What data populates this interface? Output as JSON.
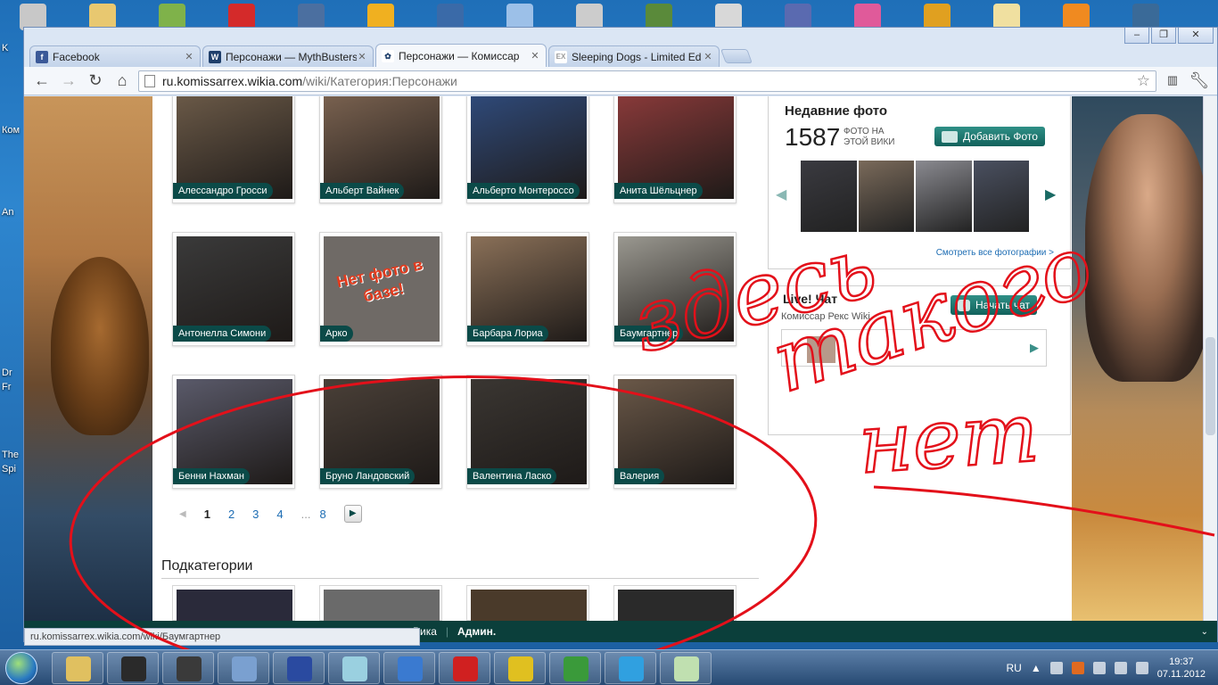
{
  "desktop": {
    "left_labels": [
      "K",
      "Ком",
      "An",
      "Dr",
      "Fr",
      "The",
      "Spi"
    ],
    "icon_colors": [
      "#c8c8c8",
      "#e8c870",
      "#7fb24a",
      "#d42a2a",
      "#4b6fa0",
      "#f0b020",
      "#3a6aa8",
      "#9cc0e8",
      "#cccccc",
      "#5a8a3a",
      "#d8d8d8",
      "#5a6ab0",
      "#e05a9a",
      "#e0a020",
      "#f0e0a0",
      "#f08a20",
      "#3a6a98"
    ]
  },
  "browser": {
    "tabs": [
      {
        "label": "Facebook",
        "icon": "facebook-icon",
        "icon_glyph": "f",
        "color": "#3b5998"
      },
      {
        "label": "Персонажи — MythBusters",
        "icon": "wikia-icon",
        "icon_glyph": "W",
        "color": "#1f3f6b"
      },
      {
        "label": "Персонажи — Комиссар",
        "icon": "wikia-icon",
        "icon_glyph": "✿",
        "color": "#1f3f6b",
        "active": true
      },
      {
        "label": "Sleeping Dogs - Limited Ed",
        "icon": "ex-icon",
        "icon_glyph": "EX",
        "color": "#9a9a9a"
      }
    ],
    "close_glyph": "✕",
    "url_host": "ru.komissarrex.wikia.com",
    "url_path": "/wiki/Категория:Персонажи"
  },
  "characters": [
    {
      "name": "Алессандро Гросси",
      "color": "#6b5a48"
    },
    {
      "name": "Альберт Вайнек",
      "color": "#7a6250"
    },
    {
      "name": "Альберто Монтероссо",
      "color": "#2f4a7a"
    },
    {
      "name": "Анита Шёльцнер",
      "color": "#8a3a3a"
    },
    {
      "name": "Антонелла Симони",
      "color": "#3a3a3a"
    },
    {
      "name": "Арко",
      "color": "#8a8a8a"
    },
    {
      "name": "Барбара Лориа",
      "color": "#8a7058"
    },
    {
      "name": "Баумгартнер",
      "color": "#9a9890"
    },
    {
      "name": "Бенни Нахман",
      "color": "#5a5a6a"
    },
    {
      "name": "Бруно Ландовский",
      "color": "#4a4038"
    },
    {
      "name": "Валентина Ласко",
      "color": "#3a3632"
    },
    {
      "name": "Валерия",
      "color": "#6a5848"
    }
  ],
  "no_photo_text": "Нет фото в базе!",
  "pager": {
    "pages": [
      "1",
      "2",
      "3",
      "4",
      "...",
      "8"
    ],
    "current": "1"
  },
  "subcategories_title": "Подкатегории",
  "subcategory_colors": [
    "#2a2a3a",
    "#6a6a6a",
    "#4a3a2a",
    "#2a2a2a"
  ],
  "recent_photos": {
    "title": "Недавние фото",
    "count": "1587",
    "count_label": "ФОТО НА ЭТОЙ ВИКИ",
    "add_button": "Добавить Фото",
    "thumb_colors": [
      "#3a3a40",
      "#7a6a5a",
      "#8a8a90",
      "#4a5060"
    ],
    "see_all": "Смотреть все фотографии >"
  },
  "live_chat": {
    "title": "Live! Чат",
    "start_button": "Начать чат",
    "wiki_name": "Комиссар Рекс Wiki"
  },
  "wiki_bar": {
    "items": [
      "Вика",
      "Админ."
    ]
  },
  "status_url": "ru.komissarrex.wikia.com/wiki/Баумгартнер",
  "annotation": {
    "line1": "здесь",
    "line2": "такого",
    "line3": "нет"
  },
  "tray": {
    "lang": "RU",
    "time": "19:37",
    "date": "07.11.2012"
  }
}
